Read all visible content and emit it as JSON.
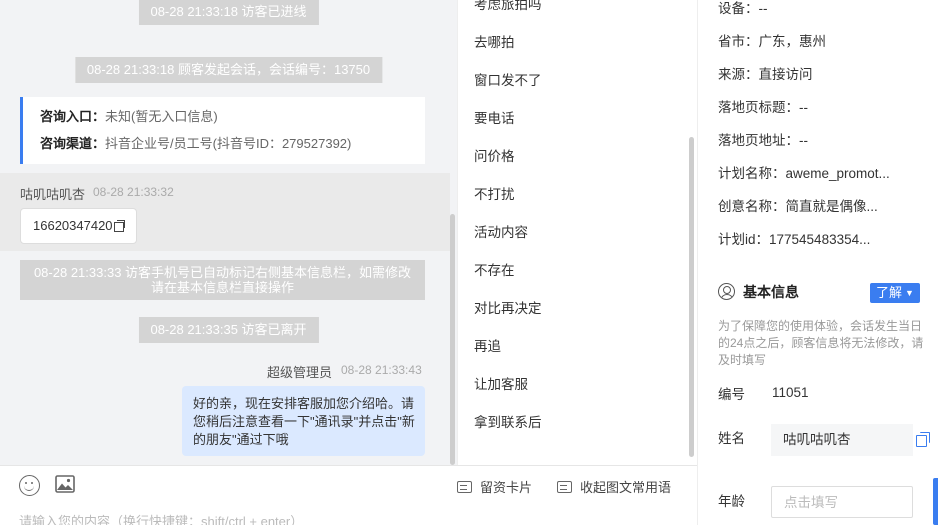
{
  "chat": {
    "sys1": "08-28 21:33:18 访客已进线",
    "sys2": "08-28 21:33:18 顾客发起会话，会话编号：13750",
    "info_card": {
      "entry_label": "咨询入口：",
      "entry_value": "未知(暂无入口信息)",
      "channel_label": "咨询渠道：",
      "channel_value": "抖音企业号/员工号(抖音号ID：279527392)"
    },
    "visitor": {
      "name": "咕叽咕叽杏",
      "time": "08-28 21:33:32",
      "phone": "16620347420"
    },
    "sys3": "08-28 21:33:33 访客手机号已自动标记右侧基本信息栏，如需修改请在基本信息栏直接操作",
    "sys4": "08-28 21:33:35 访客已离开",
    "agent": {
      "name": "超级管理员",
      "time": "08-28 21:33:43",
      "message": "好的亲，现在安排客服加您介绍哈。请您稍后注意查看一下\"通讯录\"并点击\"新的朋友\"通过下哦"
    }
  },
  "input_bar": {
    "card_label": "留资卡片",
    "collapse_label": "收起图文常用语",
    "placeholder": "请输入您的内容（换行快捷键：shift/ctrl + enter）"
  },
  "quick_replies": [
    "考虑旅拍吗",
    "去哪拍",
    "窗口发不了",
    "要电话",
    "问价格",
    "不打扰",
    "活动内容",
    "不存在",
    "对比再决定",
    "再追",
    "让加客服",
    "拿到联系后"
  ],
  "info": {
    "device": "设备：--",
    "region": "省市：广东，惠州",
    "source": "来源：直接访问",
    "landing_title": "落地页标题：--",
    "landing_url": "落地页地址：--",
    "plan_name": "计划名称：aweme_promot...",
    "creative_name": "创意名称：简直就是偶像...",
    "plan_id": "计划id：177545483354...",
    "basic_title": "基本信息",
    "learn_btn": "了解",
    "notice": "为了保障您的使用体验，会话发生当日的24点之后，顾客信息将无法修改，请及时填写",
    "id_label": "编号",
    "id_value": "11051",
    "name_label": "姓名",
    "name_value": "咕叽咕叽杏",
    "age_label": "年龄",
    "age_placeholder": "点击填写"
  },
  "colors": {
    "accent": "#3a7df0",
    "agent_bubble": "#dbe9ff",
    "system_pill": "#d4d4d4",
    "chat_bg": "#f2f3f5"
  }
}
